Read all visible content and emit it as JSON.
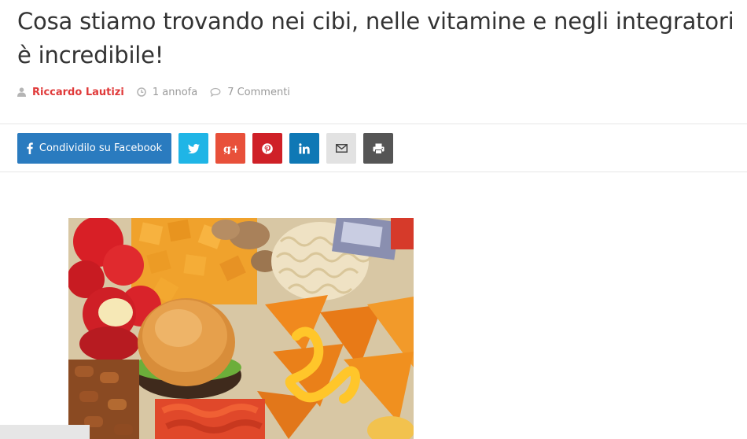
{
  "article": {
    "title": "Cosa stiamo trovando nei cibi, nelle vitamine e negli integratori è incredibile!",
    "author": "Riccardo Lautizi",
    "date": "1 annofa",
    "comments": "7 Commenti"
  },
  "share": {
    "facebook_label": "Condividilo su Facebook",
    "buttons": [
      {
        "icon": "twitter-icon",
        "color": "#1fb5e6"
      },
      {
        "icon": "google-plus-icon",
        "color": "#e8503a",
        "text": "g+"
      },
      {
        "icon": "pinterest-icon",
        "color": "#cf2027"
      },
      {
        "icon": "linkedin-icon",
        "color": "#0f78b5",
        "text": "in"
      },
      {
        "icon": "email-icon",
        "color": "#e2e2e2"
      },
      {
        "icon": "print-icon",
        "color": "#555555"
      }
    ],
    "facebook_color": "#2a7bbf"
  },
  "colors": {
    "title": "#333333",
    "author": "#e03a3a",
    "meta": "#9a9a9a"
  }
}
